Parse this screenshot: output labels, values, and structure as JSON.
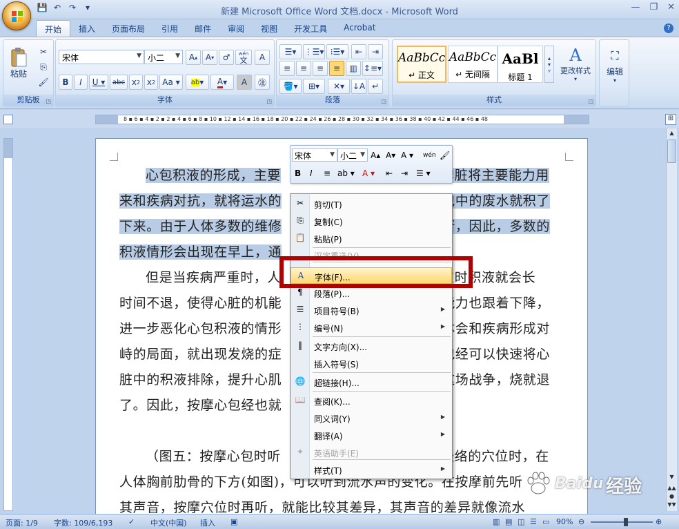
{
  "window": {
    "title": "新建 Microsoft Office Word 文档.docx - Microsoft Word",
    "qat": [
      "💾",
      "↶",
      "↷",
      "▾"
    ],
    "controls": [
      "—",
      "❐",
      "✕"
    ]
  },
  "ribbon": {
    "tabs": [
      "开始",
      "插入",
      "页面布局",
      "引用",
      "邮件",
      "审阅",
      "视图",
      "开发工具",
      "Acrobat"
    ],
    "active_tab": "开始",
    "groups": {
      "clipboard": {
        "label": "剪贴板",
        "paste": "粘贴"
      },
      "font": {
        "label": "字体",
        "font_name": "宋体",
        "font_size": "小二",
        "wen": "wén",
        "wen_char": "文"
      },
      "paragraph": {
        "label": "段落"
      },
      "styles": {
        "label": "样式",
        "items": [
          {
            "sample": "AaBbCc",
            "name": "↵ 正文"
          },
          {
            "sample": "AaBbCc",
            "name": "↵ 无间隔"
          },
          {
            "sample": "AaBl",
            "name": "标题 1"
          }
        ],
        "change_styles": "更改样式"
      },
      "editing": {
        "label": "编辑"
      }
    }
  },
  "ruler": {
    "numbers": "8 ▪ 6 ▪ 4 ▪ 2 ▪ 2 ▪ 4 ▪ 6 ▪ 8 ▪ 10 ▪ 12 ▪ 14 ▪ 16 ▪ 18 ▪ 20 ▪ 22 ▪ 24 ▪ 26 ▪ 28 ▪ 30 ▪ 32 ▪ 34 ▪ 36 ▪ 38 ▪ 40 ▪ 42 ▪ 44 ▪ 46 ▪ 48"
  },
  "document": {
    "p1_sel_a": "心包积液的形成，主要",
    "p1_sel_b": "脾脏将主要能力用",
    "p1_l2a": "来和疾病对抗，就将运水的",
    "p1_l2b": "包中的废水就积了",
    "p1_l3a": "下来。由于人体多数的维修",
    "p1_l3b": "行，因此，多数的",
    "p1_l4a": "积液情形会出现在早上，通",
    "p2_l1a": "但是当疾病严重时，人",
    "p2_l1b": "这时积液就会长",
    "p2_l2a": "时间不退，使得心脏的机能",
    "p2_l2b": "能力也跟着下降，",
    "p2_l3a": "进一步恶化心包积液的情形",
    "p2_l3b": "体会和疾病形成对",
    "p2_l4a": "峙的局面，就出现发烧的症",
    "p2_l4b": "包经可以快速将心",
    "p2_l5a": "脏中的积液排除，提升心肌",
    "p2_l5b": "这场战争，烧就退",
    "p2_l6a": "了。因此，按摩心包经也就",
    "p3_l1a": "（图五：按摩心包时听",
    "p3_l1b": "经络的穴位时，在",
    "p3_l2": "人体胸前肋骨的下方(如图)，可以听到流水声的变化。在按摩前先听",
    "p3_l3": "其声音，按摩穴位时再听，就能比较其差异，其声音的差异就像流水"
  },
  "mini_toolbar": {
    "font_name": "宋体",
    "font_size": "小二",
    "buttons_row1": [
      "A▴",
      "A▾",
      "A ▾",
      "wén",
      "🖌"
    ],
    "buttons_row2": [
      "B",
      "I",
      "≡",
      "ab ▾",
      "A ▾",
      "⇤",
      "⇥",
      "☰ ▾"
    ]
  },
  "context_menu": {
    "items": [
      {
        "icon": "✂",
        "label": "剪切(T)"
      },
      {
        "icon": "⎘",
        "label": "复制(C)"
      },
      {
        "icon": "📋",
        "label": "粘贴(P)"
      },
      {
        "icon": "",
        "label": "汉字重选(V)",
        "disabled": true
      },
      {
        "icon": "A",
        "label": "字体(F)..."
      },
      {
        "icon": "¶",
        "label": "段落(P)..."
      },
      {
        "icon": "☰",
        "label": "项目符号(B)",
        "sub": "▶"
      },
      {
        "icon": "⋮",
        "label": "编号(N)",
        "sub": "▶"
      },
      {
        "icon": "‖",
        "label": "文字方向(X)..."
      },
      {
        "icon": "",
        "label": "插入符号(S)"
      },
      {
        "icon": "🌐",
        "label": "超链接(H)..."
      },
      {
        "icon": "📖",
        "label": "查阅(K)..."
      },
      {
        "icon": "",
        "label": "同义词(Y)",
        "sub": "▶"
      },
      {
        "icon": "",
        "label": "翻译(A)",
        "sub": "▶"
      },
      {
        "icon": "✦",
        "label": "英语助手(E)",
        "disabled": true
      },
      {
        "icon": "",
        "label": "样式(T)",
        "sub": "▶"
      }
    ],
    "highlighted": "字体(F)..."
  },
  "status_bar": {
    "page": "页面: 1/9",
    "words": "字数: 109/6,193",
    "language": "中文(中国)",
    "mode": "插入",
    "zoom": "90%",
    "zoom_minus": "⊖",
    "zoom_plus": "⊕"
  },
  "watermark": {
    "brand": "Baidu",
    "text": "经验"
  }
}
